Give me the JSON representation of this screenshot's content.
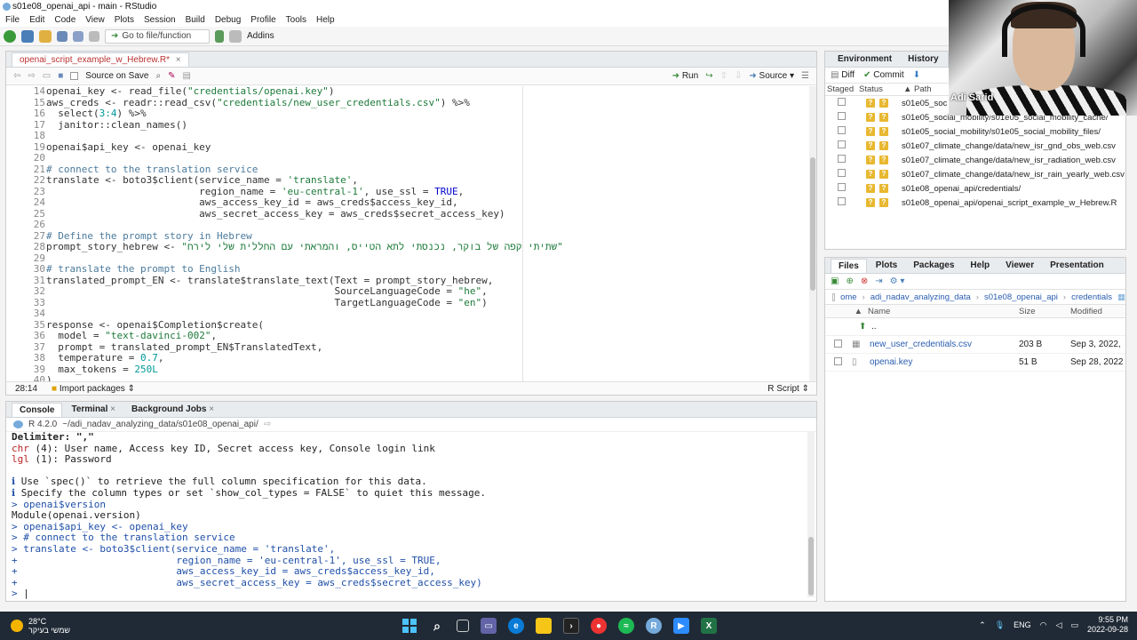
{
  "window": {
    "title": "s01e08_openai_api - main - RStudio"
  },
  "menu": [
    "File",
    "Edit",
    "Code",
    "View",
    "Plots",
    "Session",
    "Build",
    "Debug",
    "Profile",
    "Tools",
    "Help"
  ],
  "toolbar": {
    "goto_placeholder": "Go to file/function",
    "addins": "Addins"
  },
  "source": {
    "tab": "openai_script_example_w_Hebrew.R*",
    "source_on_save": "Source on Save",
    "run": "Run",
    "source_btn": "Source",
    "line_numbers": [
      "14",
      "15",
      "16",
      "17",
      "18",
      "19",
      "20",
      "21",
      "22",
      "23",
      "24",
      "25",
      "26",
      "27",
      "28",
      "29",
      "30",
      "31",
      "32",
      "33",
      "34",
      "35",
      "36",
      "37",
      "38",
      "39",
      "40"
    ],
    "cursor_pos": "28:14",
    "import_packages": "Import packages",
    "file_type": "R Script"
  },
  "console": {
    "tabs": [
      "Console",
      "Terminal",
      "Background Jobs"
    ],
    "r_version": "R 4.2.0",
    "path": "~/adi_nadav_analyzing_data/s01e08_openai_api/"
  },
  "environment": {
    "tabs": [
      "Environment",
      "History",
      "Co"
    ],
    "diff": "Diff",
    "commit": "Commit",
    "columns": [
      "Staged",
      "Status",
      "Path"
    ],
    "rows": [
      "s01e05_soc",
      "s01e05_social_mobility/s01e05_social_mobility_cache/",
      "s01e05_social_mobility/s01e05_social_mobility_files/",
      "s01e07_climate_change/data/new_isr_gnd_obs_web.csv",
      "s01e07_climate_change/data/new_isr_radiation_web.csv",
      "s01e07_climate_change/data/new_isr_rain_yearly_web.csv",
      "s01e08_openai_api/credentials/",
      "s01e08_openai_api/openai_script_example_w_Hebrew.R"
    ]
  },
  "files": {
    "tabs": [
      "Files",
      "Plots",
      "Packages",
      "Help",
      "Viewer",
      "Presentation"
    ],
    "breadcrumb": [
      "ome",
      "adi_nadav_analyzing_data",
      "s01e08_openai_api",
      "credentials"
    ],
    "columns": [
      "Name",
      "Size",
      "Modified"
    ],
    "up": "..",
    "rows": [
      {
        "name": "new_user_credentials.csv",
        "size": "203 B",
        "modified": "Sep 3, 2022,"
      },
      {
        "name": "openai.key",
        "size": "51 B",
        "modified": "Sep 28, 2022"
      }
    ]
  },
  "webcam": {
    "name": "Adi Sarid"
  },
  "taskbar": {
    "temp": "28°C",
    "weather_text": "שמשי בעיקר",
    "lang": "ENG",
    "time": "9:55 PM",
    "date": "2022-09-28"
  },
  "colors": {
    "accent": "#75aadb",
    "taskbar": "#202a36",
    "comment": "#4b7a9c",
    "string": "#1d7a3a",
    "prompt": "#1f4fa8"
  }
}
